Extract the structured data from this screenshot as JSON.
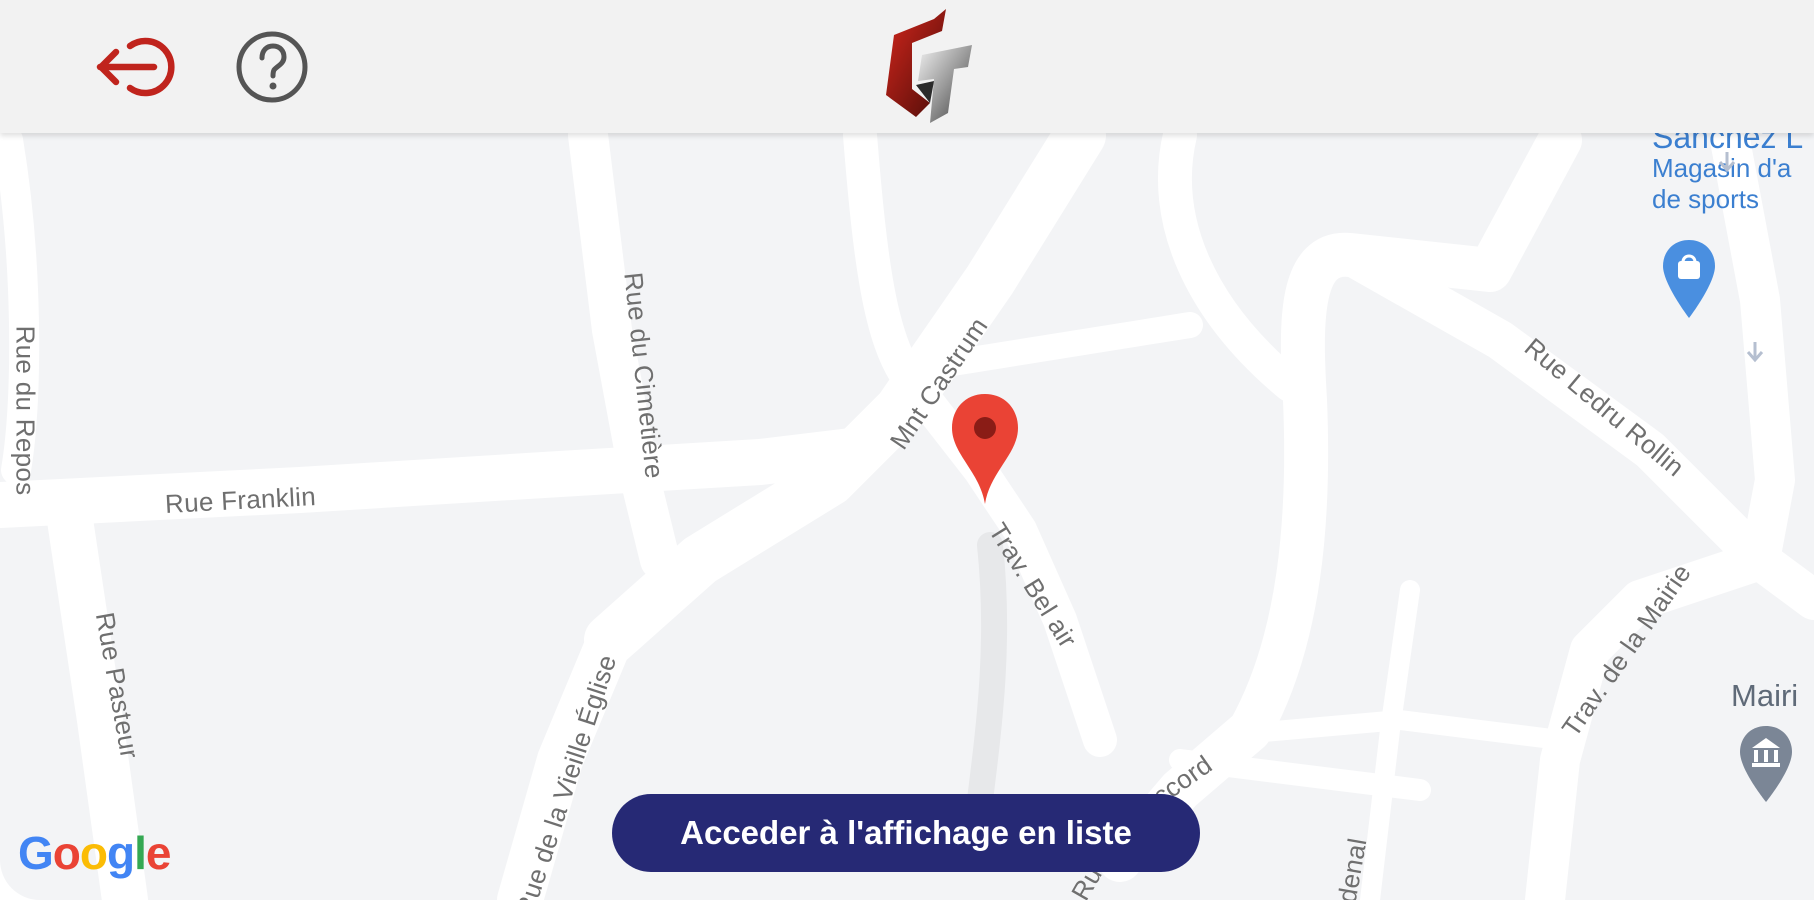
{
  "colors": {
    "map_background": "#f3f4f6",
    "road": "#ffffff",
    "topbar": "#f2f2f2",
    "logout_icon": "#c0241d",
    "help_icon": "#555555",
    "button": "#262975",
    "button_text": "#ffffff",
    "pin": "#ea4335",
    "pin_dot": "#8a1c16",
    "poi_shop": "#3b7fd0",
    "poi_townhall": "#5f6a78"
  },
  "header": {
    "logout_icon": "logout-icon",
    "help_icon": "help-icon",
    "logo_icon": "gt-logo"
  },
  "map": {
    "streets": [
      "Rue du Repos",
      "Rue du Cimetière",
      "Mnt Castrum",
      "Rue Franklin",
      "Trav. Bel air",
      "Rue Pasteur",
      "Rue de la Vieille Église",
      "Rue Ledru Rollin",
      "Trav. de la Mairie",
      "ccord",
      "denal",
      "Ru"
    ],
    "poi_shop": {
      "name": "Sanchez L",
      "line1": "Magasin d'a",
      "line2": "de sports",
      "icon": "shopping-bag-pin-icon"
    },
    "poi_townhall": {
      "name": "Mairi",
      "icon": "townhall-pin-icon"
    },
    "marker_icon": "map-marker-icon",
    "attribution": {
      "G": "G",
      "o1": "o",
      "o2": "o",
      "g": "g",
      "l": "l",
      "e": "e"
    }
  },
  "list_button": {
    "label": "Acceder à l'affichage en liste"
  }
}
